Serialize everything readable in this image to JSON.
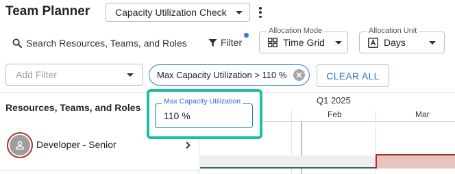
{
  "header": {
    "title": "Team Planner",
    "view_select": "Capacity Utilization Check"
  },
  "toolbar": {
    "search_placeholder": "Search Resources, Teams, and Roles",
    "filter_label": "Filter",
    "allocation_mode": {
      "label": "Allocation Mode",
      "value": "Time Grid",
      "icon": "grid-icon"
    },
    "allocation_unit": {
      "label": "Allocation Unit",
      "value": "Days",
      "icon": "unit-icon"
    }
  },
  "filters": {
    "add_placeholder": "Add Filter",
    "active_chip": "Max Capacity Utilization > 110 %",
    "clear_all": "CLEAR ALL"
  },
  "grid": {
    "column_title": "Resources, Teams, and Roles",
    "quarter": "Q1 2025",
    "months": [
      "Feb",
      "Mar"
    ],
    "rows": [
      {
        "name": "Developer - Senior",
        "avatar_icon": "person-icon"
      }
    ]
  },
  "popover": {
    "label": "Max Capacity Utilization",
    "value": "110 %"
  },
  "colors": {
    "accent": "#2e7cd6",
    "popover_border": "#1bbfa3",
    "over_allocation": "#e8c4c1",
    "over_allocation_border": "#a93226",
    "capacity_line": "#2e6e3e"
  }
}
